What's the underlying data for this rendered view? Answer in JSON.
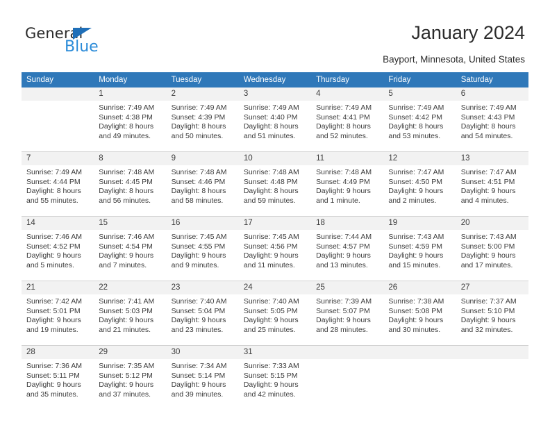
{
  "brand": {
    "name_dark": "General",
    "name_blue": "Blue",
    "accent_color": "#2b8bd8",
    "triangle_color": "#1f6fb8"
  },
  "header": {
    "title": "January 2024",
    "subtitle": "Bayport, Minnesota, United States"
  },
  "calendar": {
    "header_bg": "#2f78b9",
    "daynum_bg": "#f2f2f2",
    "weekdays": [
      "Sunday",
      "Monday",
      "Tuesday",
      "Wednesday",
      "Thursday",
      "Friday",
      "Saturday"
    ],
    "weeks": [
      [
        {
          "day": "",
          "blank": true
        },
        {
          "day": "1",
          "sunrise": "Sunrise: 7:49 AM",
          "sunset": "Sunset: 4:38 PM",
          "daylight_1": "Daylight: 8 hours",
          "daylight_2": "and 49 minutes."
        },
        {
          "day": "2",
          "sunrise": "Sunrise: 7:49 AM",
          "sunset": "Sunset: 4:39 PM",
          "daylight_1": "Daylight: 8 hours",
          "daylight_2": "and 50 minutes."
        },
        {
          "day": "3",
          "sunrise": "Sunrise: 7:49 AM",
          "sunset": "Sunset: 4:40 PM",
          "daylight_1": "Daylight: 8 hours",
          "daylight_2": "and 51 minutes."
        },
        {
          "day": "4",
          "sunrise": "Sunrise: 7:49 AM",
          "sunset": "Sunset: 4:41 PM",
          "daylight_1": "Daylight: 8 hours",
          "daylight_2": "and 52 minutes."
        },
        {
          "day": "5",
          "sunrise": "Sunrise: 7:49 AM",
          "sunset": "Sunset: 4:42 PM",
          "daylight_1": "Daylight: 8 hours",
          "daylight_2": "and 53 minutes."
        },
        {
          "day": "6",
          "sunrise": "Sunrise: 7:49 AM",
          "sunset": "Sunset: 4:43 PM",
          "daylight_1": "Daylight: 8 hours",
          "daylight_2": "and 54 minutes."
        }
      ],
      [
        {
          "day": "7",
          "sunrise": "Sunrise: 7:49 AM",
          "sunset": "Sunset: 4:44 PM",
          "daylight_1": "Daylight: 8 hours",
          "daylight_2": "and 55 minutes."
        },
        {
          "day": "8",
          "sunrise": "Sunrise: 7:48 AM",
          "sunset": "Sunset: 4:45 PM",
          "daylight_1": "Daylight: 8 hours",
          "daylight_2": "and 56 minutes."
        },
        {
          "day": "9",
          "sunrise": "Sunrise: 7:48 AM",
          "sunset": "Sunset: 4:46 PM",
          "daylight_1": "Daylight: 8 hours",
          "daylight_2": "and 58 minutes."
        },
        {
          "day": "10",
          "sunrise": "Sunrise: 7:48 AM",
          "sunset": "Sunset: 4:48 PM",
          "daylight_1": "Daylight: 8 hours",
          "daylight_2": "and 59 minutes."
        },
        {
          "day": "11",
          "sunrise": "Sunrise: 7:48 AM",
          "sunset": "Sunset: 4:49 PM",
          "daylight_1": "Daylight: 9 hours",
          "daylight_2": "and 1 minute."
        },
        {
          "day": "12",
          "sunrise": "Sunrise: 7:47 AM",
          "sunset": "Sunset: 4:50 PM",
          "daylight_1": "Daylight: 9 hours",
          "daylight_2": "and 2 minutes."
        },
        {
          "day": "13",
          "sunrise": "Sunrise: 7:47 AM",
          "sunset": "Sunset: 4:51 PM",
          "daylight_1": "Daylight: 9 hours",
          "daylight_2": "and 4 minutes."
        }
      ],
      [
        {
          "day": "14",
          "sunrise": "Sunrise: 7:46 AM",
          "sunset": "Sunset: 4:52 PM",
          "daylight_1": "Daylight: 9 hours",
          "daylight_2": "and 5 minutes."
        },
        {
          "day": "15",
          "sunrise": "Sunrise: 7:46 AM",
          "sunset": "Sunset: 4:54 PM",
          "daylight_1": "Daylight: 9 hours",
          "daylight_2": "and 7 minutes."
        },
        {
          "day": "16",
          "sunrise": "Sunrise: 7:45 AM",
          "sunset": "Sunset: 4:55 PM",
          "daylight_1": "Daylight: 9 hours",
          "daylight_2": "and 9 minutes."
        },
        {
          "day": "17",
          "sunrise": "Sunrise: 7:45 AM",
          "sunset": "Sunset: 4:56 PM",
          "daylight_1": "Daylight: 9 hours",
          "daylight_2": "and 11 minutes."
        },
        {
          "day": "18",
          "sunrise": "Sunrise: 7:44 AM",
          "sunset": "Sunset: 4:57 PM",
          "daylight_1": "Daylight: 9 hours",
          "daylight_2": "and 13 minutes."
        },
        {
          "day": "19",
          "sunrise": "Sunrise: 7:43 AM",
          "sunset": "Sunset: 4:59 PM",
          "daylight_1": "Daylight: 9 hours",
          "daylight_2": "and 15 minutes."
        },
        {
          "day": "20",
          "sunrise": "Sunrise: 7:43 AM",
          "sunset": "Sunset: 5:00 PM",
          "daylight_1": "Daylight: 9 hours",
          "daylight_2": "and 17 minutes."
        }
      ],
      [
        {
          "day": "21",
          "sunrise": "Sunrise: 7:42 AM",
          "sunset": "Sunset: 5:01 PM",
          "daylight_1": "Daylight: 9 hours",
          "daylight_2": "and 19 minutes."
        },
        {
          "day": "22",
          "sunrise": "Sunrise: 7:41 AM",
          "sunset": "Sunset: 5:03 PM",
          "daylight_1": "Daylight: 9 hours",
          "daylight_2": "and 21 minutes."
        },
        {
          "day": "23",
          "sunrise": "Sunrise: 7:40 AM",
          "sunset": "Sunset: 5:04 PM",
          "daylight_1": "Daylight: 9 hours",
          "daylight_2": "and 23 minutes."
        },
        {
          "day": "24",
          "sunrise": "Sunrise: 7:40 AM",
          "sunset": "Sunset: 5:05 PM",
          "daylight_1": "Daylight: 9 hours",
          "daylight_2": "and 25 minutes."
        },
        {
          "day": "25",
          "sunrise": "Sunrise: 7:39 AM",
          "sunset": "Sunset: 5:07 PM",
          "daylight_1": "Daylight: 9 hours",
          "daylight_2": "and 28 minutes."
        },
        {
          "day": "26",
          "sunrise": "Sunrise: 7:38 AM",
          "sunset": "Sunset: 5:08 PM",
          "daylight_1": "Daylight: 9 hours",
          "daylight_2": "and 30 minutes."
        },
        {
          "day": "27",
          "sunrise": "Sunrise: 7:37 AM",
          "sunset": "Sunset: 5:10 PM",
          "daylight_1": "Daylight: 9 hours",
          "daylight_2": "and 32 minutes."
        }
      ],
      [
        {
          "day": "28",
          "sunrise": "Sunrise: 7:36 AM",
          "sunset": "Sunset: 5:11 PM",
          "daylight_1": "Daylight: 9 hours",
          "daylight_2": "and 35 minutes."
        },
        {
          "day": "29",
          "sunrise": "Sunrise: 7:35 AM",
          "sunset": "Sunset: 5:12 PM",
          "daylight_1": "Daylight: 9 hours",
          "daylight_2": "and 37 minutes."
        },
        {
          "day": "30",
          "sunrise": "Sunrise: 7:34 AM",
          "sunset": "Sunset: 5:14 PM",
          "daylight_1": "Daylight: 9 hours",
          "daylight_2": "and 39 minutes."
        },
        {
          "day": "31",
          "sunrise": "Sunrise: 7:33 AM",
          "sunset": "Sunset: 5:15 PM",
          "daylight_1": "Daylight: 9 hours",
          "daylight_2": "and 42 minutes."
        },
        {
          "day": "",
          "blank": true
        },
        {
          "day": "",
          "blank": true
        },
        {
          "day": "",
          "blank": true
        }
      ]
    ]
  }
}
